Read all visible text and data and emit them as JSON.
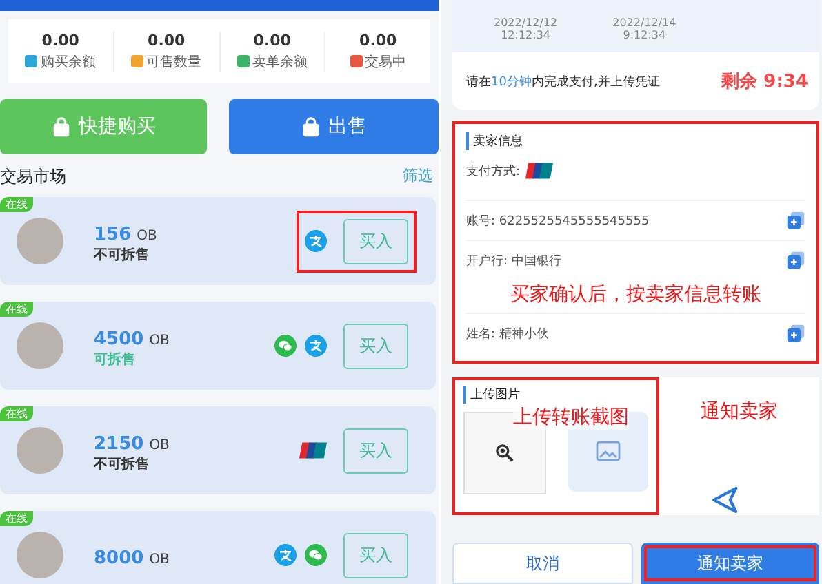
{
  "market": {
    "stats": [
      {
        "value": "0.00",
        "label": "购买余额",
        "color": "#2aa7d8"
      },
      {
        "value": "0.00",
        "label": "可售数量",
        "color": "#f0a531"
      },
      {
        "value": "0.00",
        "label": "卖单余额",
        "color": "#3bb56a"
      },
      {
        "value": "0.00",
        "label": "交易中",
        "color": "#e8573f"
      }
    ],
    "actions": [
      {
        "kind": "buy",
        "label": "快捷购买"
      },
      {
        "kind": "sell",
        "label": "出售"
      }
    ],
    "heading": "交易市场",
    "filter": "筛选",
    "offers": [
      {
        "tag": "在线",
        "amount": "156",
        "unit": "OB",
        "status": "不可拆售",
        "splittable": false,
        "payments": [
          {
            "kind": "alipay"
          }
        ],
        "buy": "买入",
        "highlighted": true
      },
      {
        "tag": "在线",
        "amount": "4500",
        "unit": "OB",
        "status": "可拆售",
        "splittable": true,
        "payments": [
          {
            "kind": "wechat"
          },
          {
            "kind": "alipay"
          }
        ],
        "buy": "买入",
        "highlighted": false
      },
      {
        "tag": "在线",
        "amount": "2150",
        "unit": "OB",
        "status": "不可拆售",
        "splittable": false,
        "payments": [
          {
            "kind": "unionpay"
          }
        ],
        "buy": "买入",
        "highlighted": false
      },
      {
        "tag": "在线",
        "amount": "8000",
        "unit": "OB",
        "payments": [
          {
            "kind": "alipay"
          },
          {
            "kind": "wechat"
          }
        ],
        "buy": "买入",
        "highlighted": false
      }
    ]
  },
  "order": {
    "times": [
      {
        "date": "2022/12/12",
        "time": "12:12:34"
      },
      {
        "date": "2022/12/14",
        "time": "9:12:34"
      }
    ],
    "notice": "请在10分钟内完成支付,并上传凭证",
    "countdown": "剩余 9:34",
    "seller": {
      "title": "卖家信息",
      "payment_label": "支付方式:",
      "payment": {
        "kind": "unionpay"
      },
      "highlighted": true,
      "fields": [
        {
          "kind": "field",
          "text": "账号: 6225525545555545555"
        },
        {
          "kind": "field",
          "text": "开户行: 中国银行"
        },
        {
          "kind": "annotation",
          "text": "买家确认后，按卖家信息转账"
        },
        {
          "kind": "field",
          "text": "姓名: 精神小伙"
        }
      ]
    },
    "upload": {
      "title": "上传图片",
      "highlighted": true,
      "annotation": "上传转账截图",
      "side_annotation": "通知卖家"
    },
    "buttons": [
      {
        "kind": "cancel",
        "label": "取消",
        "highlighted": false
      },
      {
        "kind": "primary",
        "label": "通知卖家",
        "highlighted": true
      }
    ]
  }
}
